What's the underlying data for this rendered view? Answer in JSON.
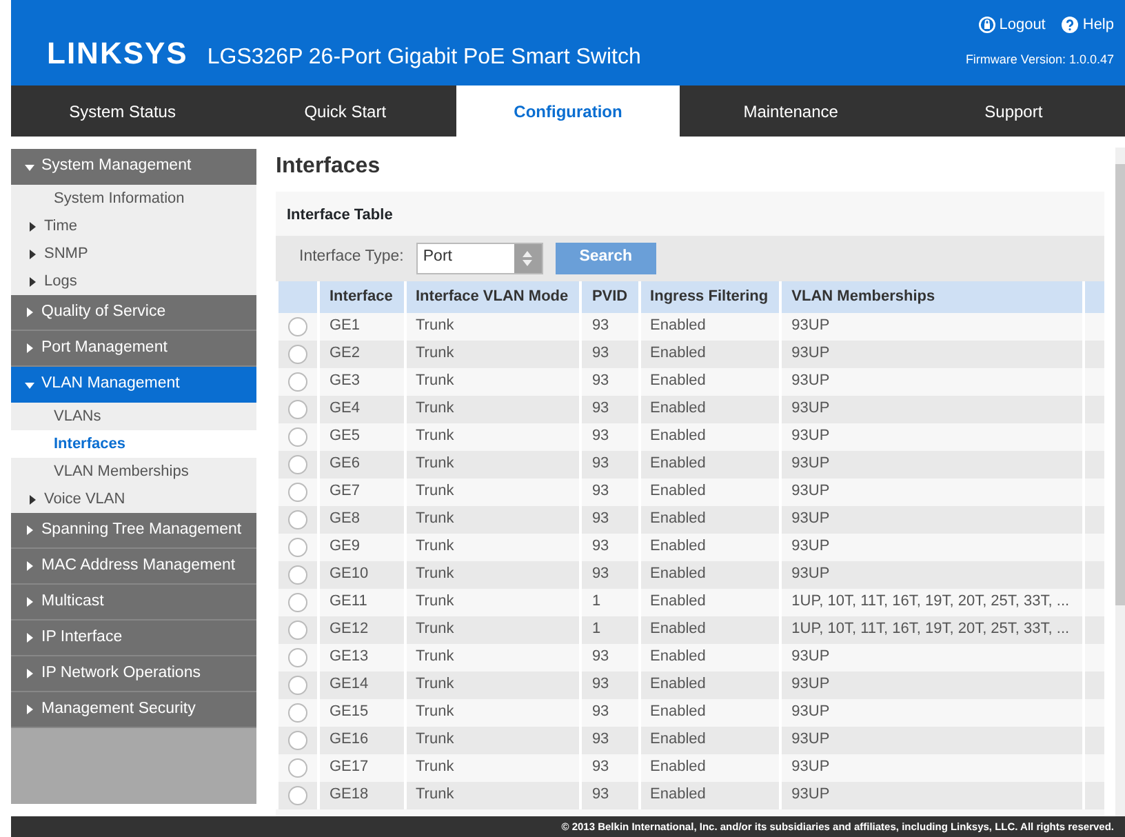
{
  "header": {
    "logo": "LINKSYS",
    "product": "LGS326P 26-Port Gigabit PoE Smart Switch",
    "links": [
      {
        "kind": "logout",
        "label": "Logout"
      },
      {
        "kind": "help",
        "label": "Help"
      }
    ],
    "firmware": "Firmware Version: 1.0.0.47"
  },
  "tabs": [
    {
      "label": "System Status",
      "selected": false
    },
    {
      "label": "Quick Start",
      "selected": false
    },
    {
      "label": "Configuration",
      "selected": true
    },
    {
      "label": "Maintenance",
      "selected": false
    },
    {
      "label": "Support",
      "selected": false
    }
  ],
  "sidebar": [
    {
      "label": "System Management",
      "expanded": true,
      "children": [
        {
          "label": "System Information",
          "kind": "leaf",
          "selected": false
        },
        {
          "label": "Time",
          "kind": "folder",
          "selected": false
        },
        {
          "label": "SNMP",
          "kind": "folder",
          "selected": false
        },
        {
          "label": "Logs",
          "kind": "folder",
          "selected": false
        }
      ]
    },
    {
      "label": "Quality of Service",
      "expanded": false
    },
    {
      "label": "Port Management",
      "expanded": false
    },
    {
      "label": "VLAN Management",
      "expanded": true,
      "children": [
        {
          "label": "VLANs",
          "kind": "leaf",
          "selected": false
        },
        {
          "label": "Interfaces",
          "kind": "leaf",
          "selected": true
        },
        {
          "label": "VLAN Memberships",
          "kind": "leaf",
          "selected": false
        },
        {
          "label": "Voice VLAN",
          "kind": "folder",
          "selected": false
        }
      ]
    },
    {
      "label": "Spanning Tree Management",
      "expanded": false
    },
    {
      "label": "MAC Address Management",
      "expanded": false
    },
    {
      "label": "Multicast",
      "expanded": false
    },
    {
      "label": "IP Interface",
      "expanded": false
    },
    {
      "label": "IP Network Operations",
      "expanded": false
    },
    {
      "label": "Management Security",
      "expanded": false
    }
  ],
  "page_title": "Interfaces",
  "panel_title": "Interface Table",
  "filter": {
    "label": "Interface Type:",
    "value": "Port",
    "button": "Search"
  },
  "table": {
    "columns": [
      "Interface",
      "Interface VLAN Mode",
      "PVID",
      "Ingress Filtering",
      "VLAN Memberships"
    ],
    "rows": [
      {
        "cells": [
          "GE1",
          "Trunk",
          "93",
          "Enabled",
          "93UP"
        ],
        "selected": false
      },
      {
        "cells": [
          "GE2",
          "Trunk",
          "93",
          "Enabled",
          "93UP"
        ],
        "selected": false
      },
      {
        "cells": [
          "GE3",
          "Trunk",
          "93",
          "Enabled",
          "93UP"
        ],
        "selected": false
      },
      {
        "cells": [
          "GE4",
          "Trunk",
          "93",
          "Enabled",
          "93UP"
        ],
        "selected": false
      },
      {
        "cells": [
          "GE5",
          "Trunk",
          "93",
          "Enabled",
          "93UP"
        ],
        "selected": false
      },
      {
        "cells": [
          "GE6",
          "Trunk",
          "93",
          "Enabled",
          "93UP"
        ],
        "selected": false
      },
      {
        "cells": [
          "GE7",
          "Trunk",
          "93",
          "Enabled",
          "93UP"
        ],
        "selected": false
      },
      {
        "cells": [
          "GE8",
          "Trunk",
          "93",
          "Enabled",
          "93UP"
        ],
        "selected": false
      },
      {
        "cells": [
          "GE9",
          "Trunk",
          "93",
          "Enabled",
          "93UP"
        ],
        "selected": false
      },
      {
        "cells": [
          "GE10",
          "Trunk",
          "93",
          "Enabled",
          "93UP"
        ],
        "selected": false
      },
      {
        "cells": [
          "GE11",
          "Trunk",
          "1",
          "Enabled",
          "1UP, 10T, 11T, 16T, 19T, 20T, 25T, 33T, ..."
        ],
        "selected": false
      },
      {
        "cells": [
          "GE12",
          "Trunk",
          "1",
          "Enabled",
          "1UP, 10T, 11T, 16T, 19T, 20T, 25T, 33T, ..."
        ],
        "selected": false
      },
      {
        "cells": [
          "GE13",
          "Trunk",
          "93",
          "Enabled",
          "93UP"
        ],
        "selected": false
      },
      {
        "cells": [
          "GE14",
          "Trunk",
          "93",
          "Enabled",
          "93UP"
        ],
        "selected": false
      },
      {
        "cells": [
          "GE15",
          "Trunk",
          "93",
          "Enabled",
          "93UP"
        ],
        "selected": false
      },
      {
        "cells": [
          "GE16",
          "Trunk",
          "93",
          "Enabled",
          "93UP"
        ],
        "selected": false
      },
      {
        "cells": [
          "GE17",
          "Trunk",
          "93",
          "Enabled",
          "93UP"
        ],
        "selected": false
      },
      {
        "cells": [
          "GE18",
          "Trunk",
          "93",
          "Enabled",
          "93UP"
        ],
        "selected": false
      }
    ]
  },
  "footer": "© 2013 Belkin International, Inc. and/or its subsidiaries and affiliates, including Linksys, LLC. All rights reserved."
}
